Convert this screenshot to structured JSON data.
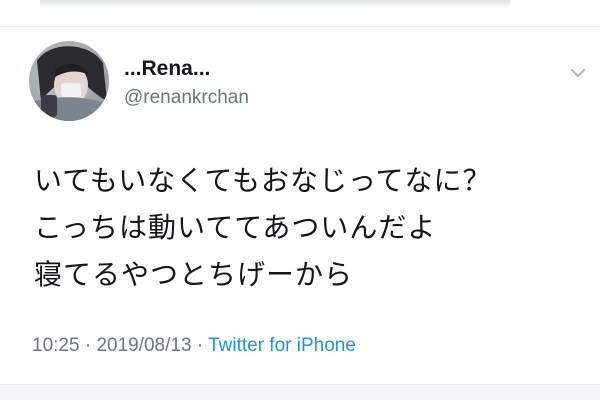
{
  "tweet": {
    "display_name": "...Rena...",
    "handle": "@renankrchan",
    "text_lines": [
      "いてもいなくてもおなじってなに？",
      "こっちは動いててあついんだよ",
      "寝てるやつとちげーから"
    ],
    "time": "10:25",
    "separator": "·",
    "date": "2019/08/13",
    "source": "Twitter for iPhone"
  },
  "icons": {
    "caret": "chevron-down-icon",
    "avatar": "profile-photo"
  },
  "colors": {
    "text": "#14171a",
    "secondary": "#657786",
    "link": "#1b95e0",
    "divider": "#e6ecf0"
  }
}
